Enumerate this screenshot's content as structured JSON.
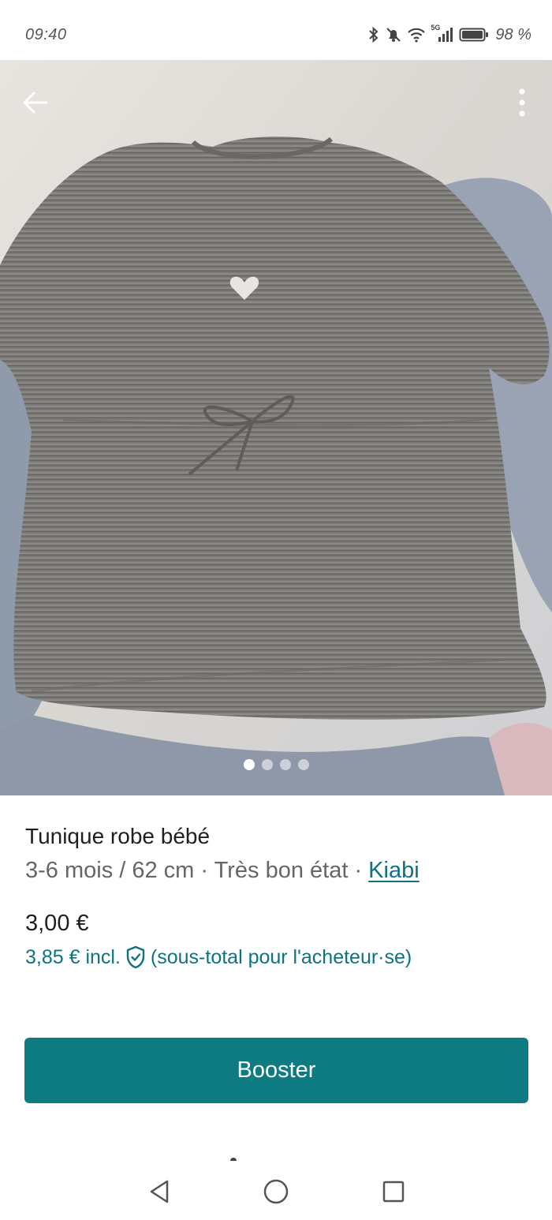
{
  "status_bar": {
    "time": "09:40",
    "battery_percent": "98 %",
    "network_label": "5G",
    "icons": [
      "bluetooth-icon",
      "mute-icon",
      "wifi-icon",
      "signal-icon",
      "battery-icon"
    ]
  },
  "photo": {
    "image_count": 4,
    "active_index": 0
  },
  "listing": {
    "title": "Tunique robe bébé",
    "size": "3-6 mois / 62 cm",
    "separator": " · ",
    "condition": "Très bon état",
    "brand": "Kiabi",
    "price": "3,00 €",
    "price_incl": "3,85 € incl.",
    "price_incl_note": "(sous-total pour l'acheteur·se)"
  },
  "actions": {
    "booster_label": "Booster"
  },
  "colors": {
    "accent": "#0e7a82",
    "link": "#0e7380"
  }
}
